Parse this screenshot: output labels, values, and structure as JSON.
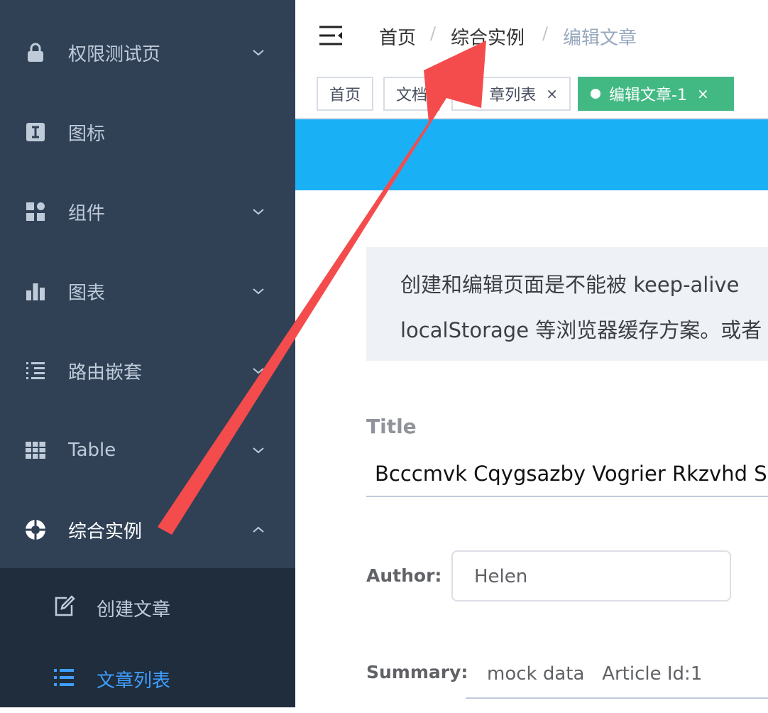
{
  "sidebar": {
    "items": [
      {
        "label": "权限测试页",
        "icon": "lock-icon",
        "expandable": true
      },
      {
        "label": "图标",
        "icon": "icon-icon",
        "expandable": false
      },
      {
        "label": "组件",
        "icon": "component-icon",
        "expandable": true
      },
      {
        "label": "图表",
        "icon": "chart-icon",
        "expandable": true
      },
      {
        "label": "路由嵌套",
        "icon": "nested-icon",
        "expandable": true
      },
      {
        "label": "Table",
        "icon": "table-icon",
        "expandable": true
      },
      {
        "label": "综合实例",
        "icon": "example-icon",
        "expanded": true
      }
    ],
    "submenu": [
      {
        "label": "创建文章",
        "icon": "edit-icon",
        "active": false
      },
      {
        "label": "文章列表",
        "icon": "list-icon",
        "active": true
      }
    ],
    "colors": {
      "bg": "#304156",
      "submenu_bg": "#1f2d3d",
      "text": "#bfcbd9",
      "active_text": "#409eff"
    }
  },
  "navbar": {
    "breadcrumb": [
      "首页",
      "综合实例",
      "编辑文章"
    ],
    "separator": "/"
  },
  "tags": [
    {
      "label": "首页",
      "closable": false,
      "active": false
    },
    {
      "label": "文档",
      "closable": false,
      "active": false
    },
    {
      "label": "章列表",
      "closable": true,
      "active": false
    },
    {
      "label": "编辑文章-1",
      "closable": true,
      "active": true
    }
  ],
  "tag_close": "×",
  "tag_active_color": "#42b983",
  "content": {
    "sticky_color": "#1ab0f6",
    "tip_lines": [
      "创建和编辑页面是不能被 keep-alive",
      "localStorage 等浏览器缓存方案。或者"
    ],
    "title_label": "Title",
    "title_value": "Bcccmvk Cqygsazby Vogrier Rkzvhd S",
    "author_label": "Author:",
    "author_value": "Helen",
    "summary_label": "Summary:",
    "summary_value": "mock data   Article Id:1"
  },
  "annotation": {
    "type": "arrow",
    "color": "#f44c4c"
  }
}
